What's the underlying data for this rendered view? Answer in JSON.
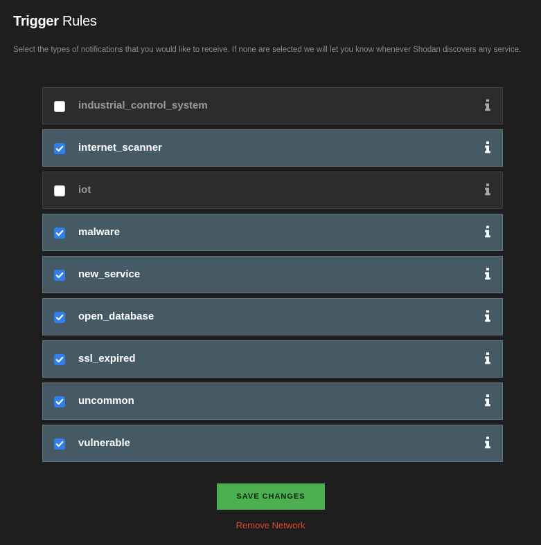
{
  "header": {
    "title_bold": "Trigger",
    "title_light": "Rules",
    "description": "Select the types of notifications that you would like to receive. If none are selected we will let you know whenever Shodan discovers any service."
  },
  "rules": [
    {
      "label": "industrial_control_system",
      "checked": false,
      "icon": "info-icon"
    },
    {
      "label": "internet_scanner",
      "checked": true,
      "icon": "info-icon"
    },
    {
      "label": "iot",
      "checked": false,
      "icon": "info-icon"
    },
    {
      "label": "malware",
      "checked": true,
      "icon": "info-icon"
    },
    {
      "label": "new_service",
      "checked": true,
      "icon": "info-icon"
    },
    {
      "label": "open_database",
      "checked": true,
      "icon": "info-icon"
    },
    {
      "label": "ssl_expired",
      "checked": true,
      "icon": "info-icon"
    },
    {
      "label": "uncommon",
      "checked": true,
      "icon": "info-icon"
    },
    {
      "label": "vulnerable",
      "checked": true,
      "icon": "info-icon"
    }
  ],
  "actions": {
    "save_label": "SAVE CHANGES",
    "remove_label": "Remove Network"
  },
  "colors": {
    "background": "#1e1e1e",
    "checked_row": "#455a64",
    "unchecked_row": "#2c2c2c",
    "checkbox_accent": "#2f80ed",
    "save_button": "#4caf50",
    "remove_link": "#e0452c"
  }
}
